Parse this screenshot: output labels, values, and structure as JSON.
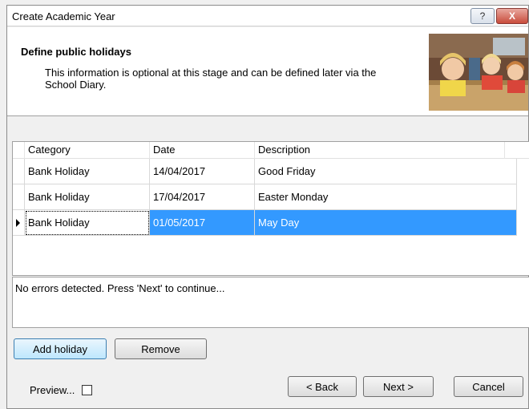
{
  "window": {
    "title": "Create Academic Year",
    "help_label": "?",
    "close_label": "X"
  },
  "header": {
    "title": "Define public holidays",
    "description": "This information is optional at this stage and can be defined later via the School Diary."
  },
  "grid": {
    "columns": [
      "Category",
      "Date",
      "Description"
    ],
    "rows": [
      {
        "category": "Bank Holiday",
        "date": "14/04/2017",
        "description": "Good Friday"
      },
      {
        "category": "Bank Holiday",
        "date": "17/04/2017",
        "description": "Easter Monday"
      },
      {
        "category": "Bank Holiday",
        "date": "01/05/2017",
        "description": "May Day"
      }
    ],
    "selected_row": 2
  },
  "status": {
    "message": "No errors detected. Press 'Next' to continue..."
  },
  "buttons": {
    "add_holiday": "Add holiday",
    "remove": "Remove",
    "back": "< Back",
    "next": "Next >",
    "cancel": "Cancel"
  },
  "preview": {
    "label": "Preview...",
    "checked": false
  },
  "colors": {
    "selection": "#3399ff",
    "close_button": "#c84b3b"
  }
}
